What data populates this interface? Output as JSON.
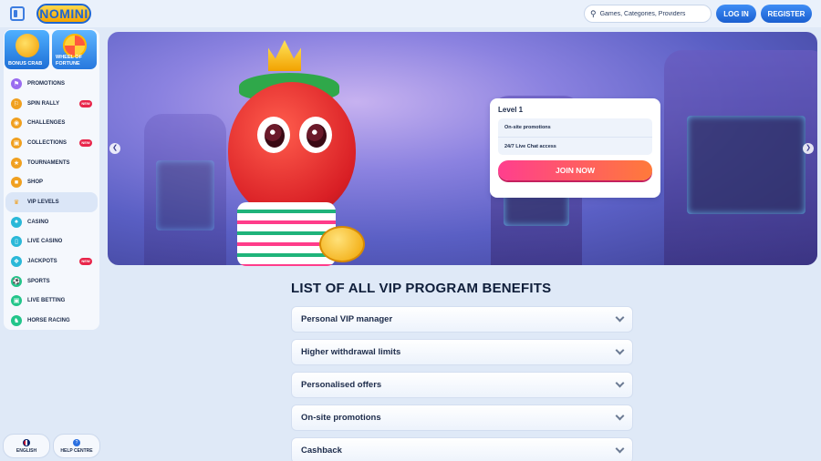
{
  "header": {
    "logo_text": "NOMINI",
    "search_placeholder": "Games, Categories, Providers",
    "login_label": "LOG IN",
    "register_label": "REGISTER"
  },
  "sidebar": {
    "tiles": [
      {
        "label": "BONUS CRAB"
      },
      {
        "label": "WHEEL OF FORTUNE"
      }
    ],
    "items": [
      {
        "label": "PROMOTIONS",
        "icon": "gift-icon",
        "color": "#9a6cf0"
      },
      {
        "label": "SPIN RALLY",
        "icon": "flag-icon",
        "color": "#f0a020",
        "badge": "NEW"
      },
      {
        "label": "CHALLENGES",
        "icon": "target-icon",
        "color": "#f0a020"
      },
      {
        "label": "COLLECTIONS",
        "icon": "cards-icon",
        "color": "#f0a020",
        "badge": "NEW"
      },
      {
        "label": "TOURNAMENTS",
        "icon": "trophy-icon",
        "color": "#f0a020"
      },
      {
        "label": "SHOP",
        "icon": "bag-icon",
        "color": "#f0a020"
      },
      {
        "label": "VIP LEVELS",
        "icon": "crown-icon",
        "color": "#f0a020",
        "active": true
      },
      {
        "label": "CASINO",
        "icon": "spade-icon",
        "color": "#2ab8d8"
      },
      {
        "label": "LIVE CASINO",
        "icon": "phone-icon",
        "color": "#2ab8d8"
      },
      {
        "label": "JACKPOTS",
        "icon": "chip-icon",
        "color": "#2ab8d8",
        "badge": "NEW"
      },
      {
        "label": "SPORTS",
        "icon": "ball-icon",
        "color": "#22c58a"
      },
      {
        "label": "LIVE BETTING",
        "icon": "monitor-icon",
        "color": "#22c58a"
      },
      {
        "label": "HORSE RACING",
        "icon": "horse-icon",
        "color": "#22c58a"
      }
    ]
  },
  "footer": {
    "language_label": "ENGLISH",
    "help_label": "HELP CENTRE",
    "help_icon_glyph": "?"
  },
  "banner": {
    "level_title": "Level 1",
    "perks": [
      "On-site promotions",
      "24/7 Live Chat access"
    ],
    "join_label": "JOIN NOW"
  },
  "benefits": {
    "title": "LIST OF ALL VIP PROGRAM BENEFITS",
    "items": [
      "Personal VIP manager",
      "Higher withdrawal limits",
      "Personalised offers",
      "On-site promotions",
      "Cashback"
    ]
  }
}
